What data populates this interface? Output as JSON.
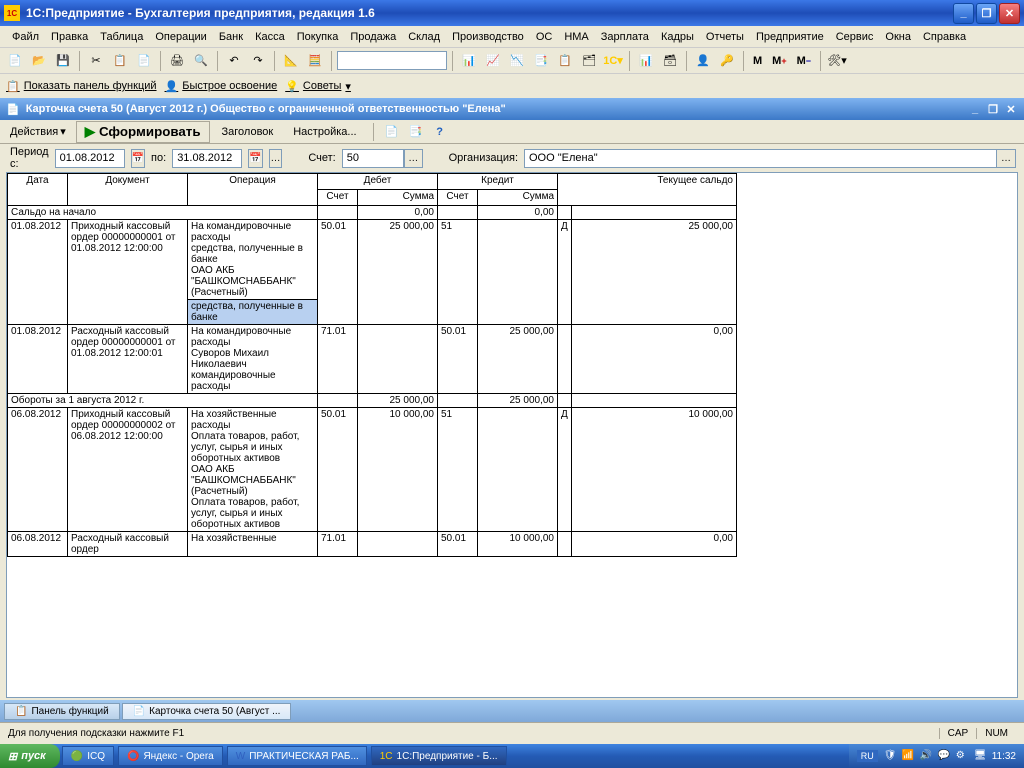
{
  "window": {
    "title": "1С:Предприятие - Бухгалтерия предприятия, редакция 1.6"
  },
  "menu": [
    "Файл",
    "Правка",
    "Таблица",
    "Операции",
    "Банк",
    "Касса",
    "Покупка",
    "Продажа",
    "Склад",
    "Производство",
    "ОС",
    "НМА",
    "Зарплата",
    "Кадры",
    "Отчеты",
    "Предприятие",
    "Сервис",
    "Окна",
    "Справка"
  ],
  "toolbar2": {
    "show_panel": "Показать панель функций",
    "quick_learn": "Быстрое освоение",
    "tips": "Советы"
  },
  "doc": {
    "title": "Карточка счета 50 (Август 2012 г.) Общество с ограниченной ответственностью \"Елена\""
  },
  "actions": {
    "label": "Действия",
    "form": "Сформировать",
    "header": "Заголовок",
    "settings": "Настройка..."
  },
  "period": {
    "label_from": "Период с:",
    "from": "01.08.2012",
    "label_to": "по:",
    "to": "31.08.2012",
    "acct_label": "Счет:",
    "acct": "50",
    "org_label": "Организация:",
    "org": "ООО \"Елена\""
  },
  "headers": {
    "date": "Дата",
    "document": "Документ",
    "operation": "Операция",
    "debit": "Дебет",
    "credit": "Кредит",
    "account": "Счет",
    "sum": "Сумма",
    "balance": "Текущее сальдо"
  },
  "rows": {
    "saldo_start": "Сальдо на начало",
    "saldo_start_d": "0,00",
    "saldo_start_c": "0,00",
    "r1": {
      "date": "01.08.2012",
      "doc": "Приходный кассовый ордер 00000000001 от 01.08.2012 12:00:00",
      "op": "На командировочные расходы\nсредства, полученные в банке\nОАО АКБ \"БАШКОМСНАББАНК\" (Расчетный)",
      "op_sel": "средства, полученные в банке",
      "d_acc": "50.01",
      "d_sum": "25 000,00",
      "c_acc": "51",
      "bal_dc": "Д",
      "bal": "25 000,00"
    },
    "r2": {
      "date": "01.08.2012",
      "doc": "Расходный кассовый ордер 00000000001 от 01.08.2012 12:00:01",
      "op": "На командировочные расходы\nСуворов Михаил Николаевич\nкомандировочные расходы",
      "d_acc": "71.01",
      "c_acc": "50.01",
      "c_sum": "25 000,00",
      "bal": "0,00"
    },
    "turnover1": {
      "label": "Обороты за 1 августа 2012 г.",
      "d": "25 000,00",
      "c": "25 000,00"
    },
    "r3": {
      "date": "06.08.2012",
      "doc": "Приходный кассовый ордер 00000000002 от 06.08.2012 12:00:00",
      "op": "На хозяйственные расходы\nОплата товаров, работ, услуг, сырья и иных оборотных активов\nОАО АКБ \"БАШКОМСНАББАНК\" (Расчетный)\nОплата товаров, работ, услуг, сырья и иных оборотных активов",
      "d_acc": "50.01",
      "d_sum": "10 000,00",
      "c_acc": "51",
      "bal_dc": "Д",
      "bal": "10 000,00"
    },
    "r4": {
      "date": "06.08.2012",
      "doc": "Расходный кассовый ордер",
      "op": "На хозяйственные",
      "d_acc": "71.01",
      "c_acc": "50.01",
      "c_sum": "10 000,00",
      "bal": "0,00"
    }
  },
  "tabs": {
    "panel": "Панель функций",
    "card": "Карточка счета 50 (Август ..."
  },
  "status": {
    "hint": "Для получения подсказки нажмите F1",
    "cap": "CAP",
    "num": "NUM"
  },
  "taskbar": {
    "start": "пуск",
    "icq": "ICQ",
    "opera": "Яндекс - Opera",
    "word": "ПРАКТИЧЕСКАЯ РАБ...",
    "onec": "1С:Предприятие - Б...",
    "lang": "RU",
    "time": "11:32"
  }
}
